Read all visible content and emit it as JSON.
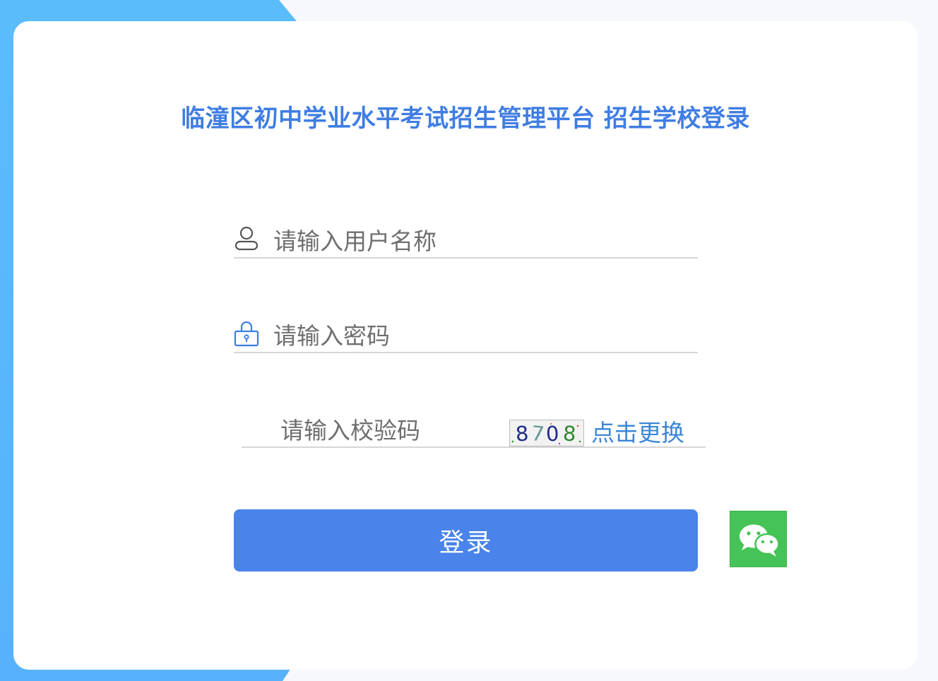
{
  "page": {
    "title": "临潼区初中学业水平考试招生管理平台 招生学校登录"
  },
  "form": {
    "username_placeholder": "请输入用户名称",
    "username_value": "",
    "password_placeholder": "请输入密码",
    "password_value": "",
    "captcha_placeholder": "请输入校验码",
    "captcha_value": "",
    "captcha_image_text": "8708",
    "refresh_label": "点击更换",
    "login_label": "登录"
  },
  "icons": {
    "username": "user-icon",
    "password": "lock-icon",
    "wechat": "wechat-icon"
  },
  "colors": {
    "accent": "#4a84ea",
    "title": "#3f7de3",
    "link": "#3c86d6",
    "wechat": "#46c356",
    "background_blue": "#5bbcfc"
  }
}
